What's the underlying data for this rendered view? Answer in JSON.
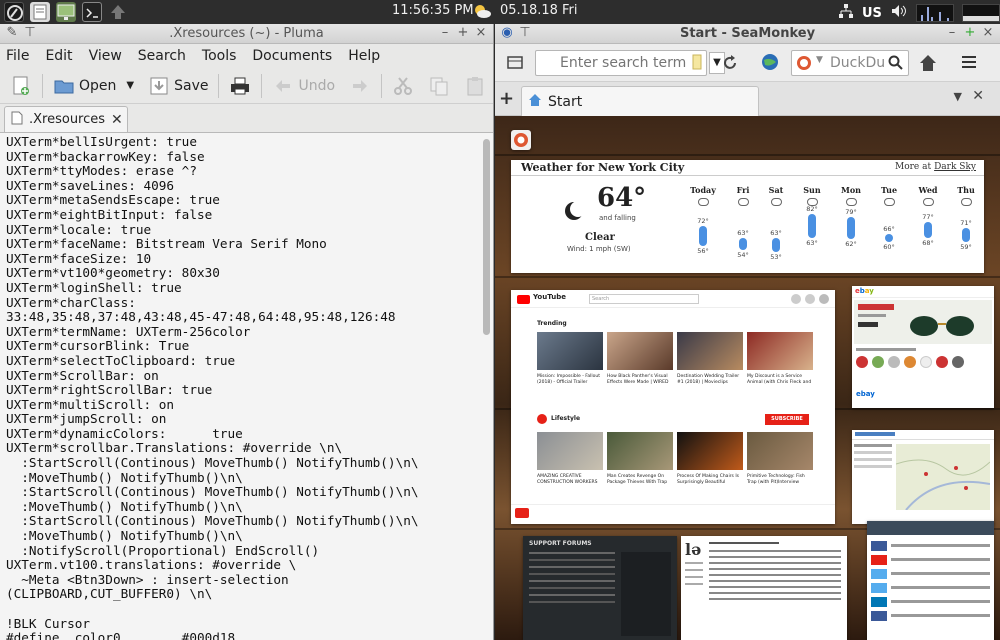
{
  "panel": {
    "clock": "11:56:35 PM",
    "date": "05.18.18 Fri",
    "keyboard_layout": "US",
    "launchers": [
      "menu-icon",
      "file-manager-icon",
      "monitor-icon",
      "terminal-icon",
      "up-arrow-icon"
    ]
  },
  "pluma": {
    "title": ".Xresources (~) - Pluma",
    "menu": [
      "File",
      "Edit",
      "View",
      "Search",
      "Tools",
      "Documents",
      "Help"
    ],
    "toolbar": {
      "open": "Open",
      "save": "Save",
      "undo": "Undo"
    },
    "tab_label": ".Xresources",
    "content": "UXTerm*bellIsUrgent: true\nUXTerm*backarrowKey: false\nUXTerm*ttyModes: erase ^?\nUXTerm*saveLines: 4096\nUXTerm*metaSendsEscape: true\nUXTerm*eightBitInput: false\nUXTerm*locale: true\nUXTerm*faceName: Bitstream Vera Serif Mono\nUXTerm*faceSize: 10\nUXTerm*vt100*geometry: 80x30\nUXTerm*loginShell: true\nUXTerm*charClass:\n33:48,35:48,37:48,43:48,45-47:48,64:48,95:48,126:48\nUXTerm*termName: UXTerm-256color\nUXTerm*cursorBlink: True\nUXTerm*selectToClipboard: true\nUXTerm*ScrollBar: on\nUXTerm*rightScrollBar: true\nUXTerm*multiScroll: on\nUXTerm*jumpScroll: on\nUXTerm*dynamicColors:      true\nUXTerm*scrollbar.Translations: #override \\n\\\n  :StartScroll(Continous) MoveThumb() NotifyThumb()\\n\\\n  :MoveThumb() NotifyThumb()\\n\\\n  :StartScroll(Continous) MoveThumb() NotifyThumb()\\n\\\n  :MoveThumb() NotifyThumb()\\n\\\n  :StartScroll(Continous) MoveThumb() NotifyThumb()\\n\\\n  :MoveThumb() NotifyThumb()\\n\\\n  :NotifyScroll(Proportional) EndScroll()\nUXTerm.vt100.translations: #override \\\n  ~Meta <Btn3Down> : insert-selection\n(CLIPBOARD,CUT_BUFFER0) \\n\\\n\n!BLK Cursor\n#define _color0        #000d18"
  },
  "seamonkey": {
    "title": "Start - SeaMonkey",
    "url_placeholder": "Enter search term",
    "search_engine": "DuckDu",
    "tab_label": "Start",
    "weather": {
      "title": "Weather for New York City",
      "more_label": "More at",
      "more_link": "Dark Sky",
      "temp": "64°",
      "trend": "and falling",
      "condition": "Clear",
      "wind": "Wind: 1 mph (SW)",
      "days": [
        {
          "name": "Today",
          "hi": "72°",
          "lo": "56°"
        },
        {
          "name": "Fri",
          "hi": "63°",
          "lo": "54°"
        },
        {
          "name": "Sat",
          "hi": "63°",
          "lo": "53°"
        },
        {
          "name": "Sun",
          "hi": "82°",
          "lo": "63°"
        },
        {
          "name": "Mon",
          "hi": "79°",
          "lo": "62°"
        },
        {
          "name": "Tue",
          "hi": "66°",
          "lo": "60°"
        },
        {
          "name": "Wed",
          "hi": "77°",
          "lo": "68°"
        },
        {
          "name": "Thu",
          "hi": "71°",
          "lo": "59°"
        }
      ]
    },
    "youtube": {
      "word": "YouTube",
      "search": "Search",
      "trending": "Trending",
      "lifestyle": "Lifestyle",
      "subscribe": "SUBSCRIBE 4.5M",
      "captions": [
        "Mission: Impossible - Fallout (2018) - Official Trailer",
        "How Black Panther's Visual Effects Were Made | WIRED",
        "Destination Wedding Trailer #1 (2018) | Movieclips",
        "My Discount is a Service Animal (with Chris Fleck and",
        "AMAZING CREATIVE CONSTRUCTION WORKERS",
        "Man Creates Revenge On Package Thieves With Trap",
        "Process Of Making Chairs Is Surprisingly Beautiful",
        "Primitive Technology: Fish Trap (with Pit)Interview"
      ]
    },
    "ebay_brand": "ebay",
    "forum_title": "SUPPORT FORUMS"
  }
}
